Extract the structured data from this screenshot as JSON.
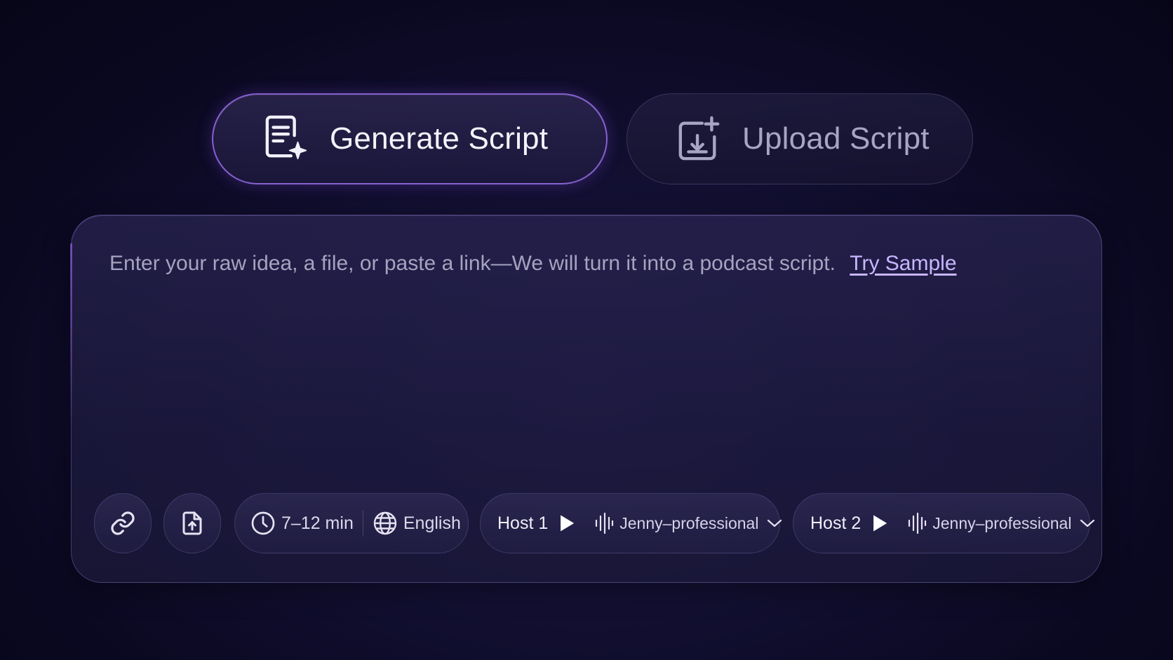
{
  "tabs": {
    "generate": {
      "label": "Generate Script",
      "icon": "document-sparkle-icon",
      "active": true
    },
    "upload": {
      "label": "Upload Script",
      "icon": "upload-plus-icon",
      "active": false
    }
  },
  "editor": {
    "placeholder": "Enter your raw idea, a file, or paste a link—We will turn it into a podcast script.",
    "try_sample": "Try Sample"
  },
  "controls": {
    "link_icon": "link-icon",
    "upload_icon": "file-upload-icon",
    "duration": "7–12 min",
    "language": "English",
    "host1": {
      "label": "Host 1",
      "voice": "Jenny–professional"
    },
    "host2": {
      "label": "Host 2",
      "voice": "Jenny–professional"
    }
  },
  "colors": {
    "accent": "#a878ff",
    "background": "#0f0c2a",
    "link": "#c8b6ff"
  }
}
